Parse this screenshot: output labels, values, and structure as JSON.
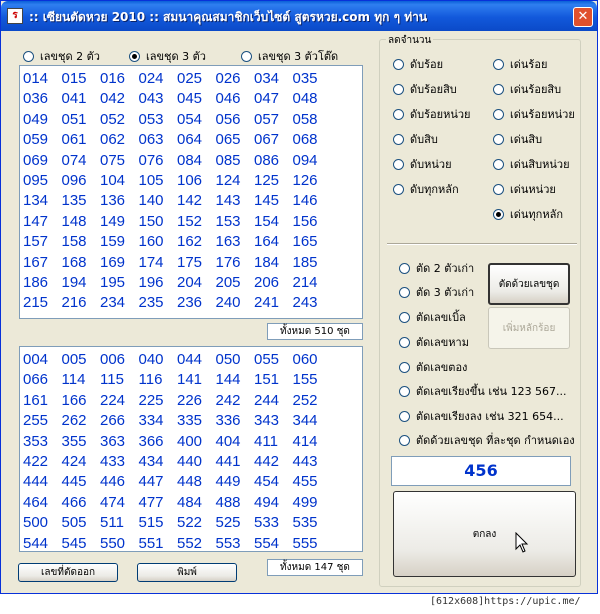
{
  "window": {
    "title": ":: เซียนตัดหวย 2010 :: สมนาคุณสมาชิกเว็บไซต์ สูตรหวย.com ทุก ๆ ท่าน",
    "close": "✕"
  },
  "top_options": [
    {
      "label": "เลขชุด 2 ตัว",
      "checked": false
    },
    {
      "label": "เลขชุด 3 ตัว",
      "checked": true
    },
    {
      "label": "เลขชุด 3 ตัวโต๊ด",
      "checked": false
    }
  ],
  "upper_list": {
    "numbers": [
      "014",
      "015",
      "016",
      "024",
      "025",
      "026",
      "034",
      "035",
      "036",
      "041",
      "042",
      "043",
      "045",
      "046",
      "047",
      "048",
      "049",
      "051",
      "052",
      "053",
      "054",
      "056",
      "057",
      "058",
      "059",
      "061",
      "062",
      "063",
      "064",
      "065",
      "067",
      "068",
      "069",
      "074",
      "075",
      "076",
      "084",
      "085",
      "086",
      "094",
      "095",
      "096",
      "104",
      "105",
      "106",
      "124",
      "125",
      "126",
      "134",
      "135",
      "136",
      "140",
      "142",
      "143",
      "145",
      "146",
      "147",
      "148",
      "149",
      "150",
      "152",
      "153",
      "154",
      "156",
      "157",
      "158",
      "159",
      "160",
      "162",
      "163",
      "164",
      "165",
      "167",
      "168",
      "169",
      "174",
      "175",
      "176",
      "184",
      "185",
      "186",
      "194",
      "195",
      "196",
      "204",
      "205",
      "206",
      "214",
      "215",
      "216",
      "234",
      "235",
      "236",
      "240",
      "241",
      "243"
    ],
    "total": "ทั้งหมด 510 ชุด"
  },
  "lower_list": {
    "numbers": [
      "004",
      "005",
      "006",
      "040",
      "044",
      "050",
      "055",
      "060",
      "066",
      "114",
      "115",
      "116",
      "141",
      "144",
      "151",
      "155",
      "161",
      "166",
      "224",
      "225",
      "226",
      "242",
      "244",
      "252",
      "255",
      "262",
      "266",
      "334",
      "335",
      "336",
      "343",
      "344",
      "353",
      "355",
      "363",
      "366",
      "400",
      "404",
      "411",
      "414",
      "422",
      "424",
      "433",
      "434",
      "440",
      "441",
      "442",
      "443",
      "444",
      "445",
      "446",
      "447",
      "448",
      "449",
      "454",
      "455",
      "464",
      "466",
      "474",
      "477",
      "484",
      "488",
      "494",
      "499",
      "500",
      "505",
      "511",
      "515",
      "522",
      "525",
      "533",
      "535",
      "544",
      "545",
      "550",
      "551",
      "552",
      "553",
      "554",
      "555"
    ],
    "total": "ทั้งหมด 147 ชุด"
  },
  "buttons": {
    "cut_numbers": "เลขที่ตัดออก",
    "print": "พิมพ์"
  },
  "reduce_group": {
    "legend": "ลดจำนวน",
    "left": [
      {
        "label": "ดับร้อย",
        "checked": false
      },
      {
        "label": "ดับร้อยสิบ",
        "checked": false
      },
      {
        "label": "ดับร้อยหน่วย",
        "checked": false
      },
      {
        "label": "ดับสิบ",
        "checked": false
      },
      {
        "label": "ดับหน่วย",
        "checked": false
      },
      {
        "label": "ดับทุกหลัก",
        "checked": false
      }
    ],
    "right": [
      {
        "label": "เด่นร้อย",
        "checked": false
      },
      {
        "label": "เด่นร้อยสิบ",
        "checked": false
      },
      {
        "label": "เด่นร้อยหน่วย",
        "checked": false
      },
      {
        "label": "เด่นสิบ",
        "checked": false
      },
      {
        "label": "เด่นสิบหน่วย",
        "checked": false
      },
      {
        "label": "เด่นหน่วย",
        "checked": false
      },
      {
        "label": "เด่นทุกหลัก",
        "checked": true
      }
    ]
  },
  "cut_options": [
    {
      "label": "ตัด 2 ตัวเก่า",
      "checked": false
    },
    {
      "label": "ตัด 3 ตัวเก่า",
      "checked": false
    },
    {
      "label": "ตัดเลขเบิ้ล",
      "checked": false
    },
    {
      "label": "ตัดเลขหาม",
      "checked": false
    },
    {
      "label": "ตัดเลขตอง",
      "checked": false
    },
    {
      "label": "ตัดเลขเรียงขึ้น เช่น 123 567...",
      "checked": false
    },
    {
      "label": "ตัดเลขเรียงลง เช่น 321 654...",
      "checked": false
    },
    {
      "label": "ตัดด้วยเลขชุด ที่ละชุด กำหนดเอง",
      "checked": false
    }
  ],
  "side_buttons": {
    "cut_by_set": "ตัดด้วยเลขชุด",
    "add_hundreds": "เพิ่มหลักร้อย"
  },
  "result_value": "456",
  "ok_button": "ตกลง",
  "watermark": "[612x608]https://upic.me/"
}
